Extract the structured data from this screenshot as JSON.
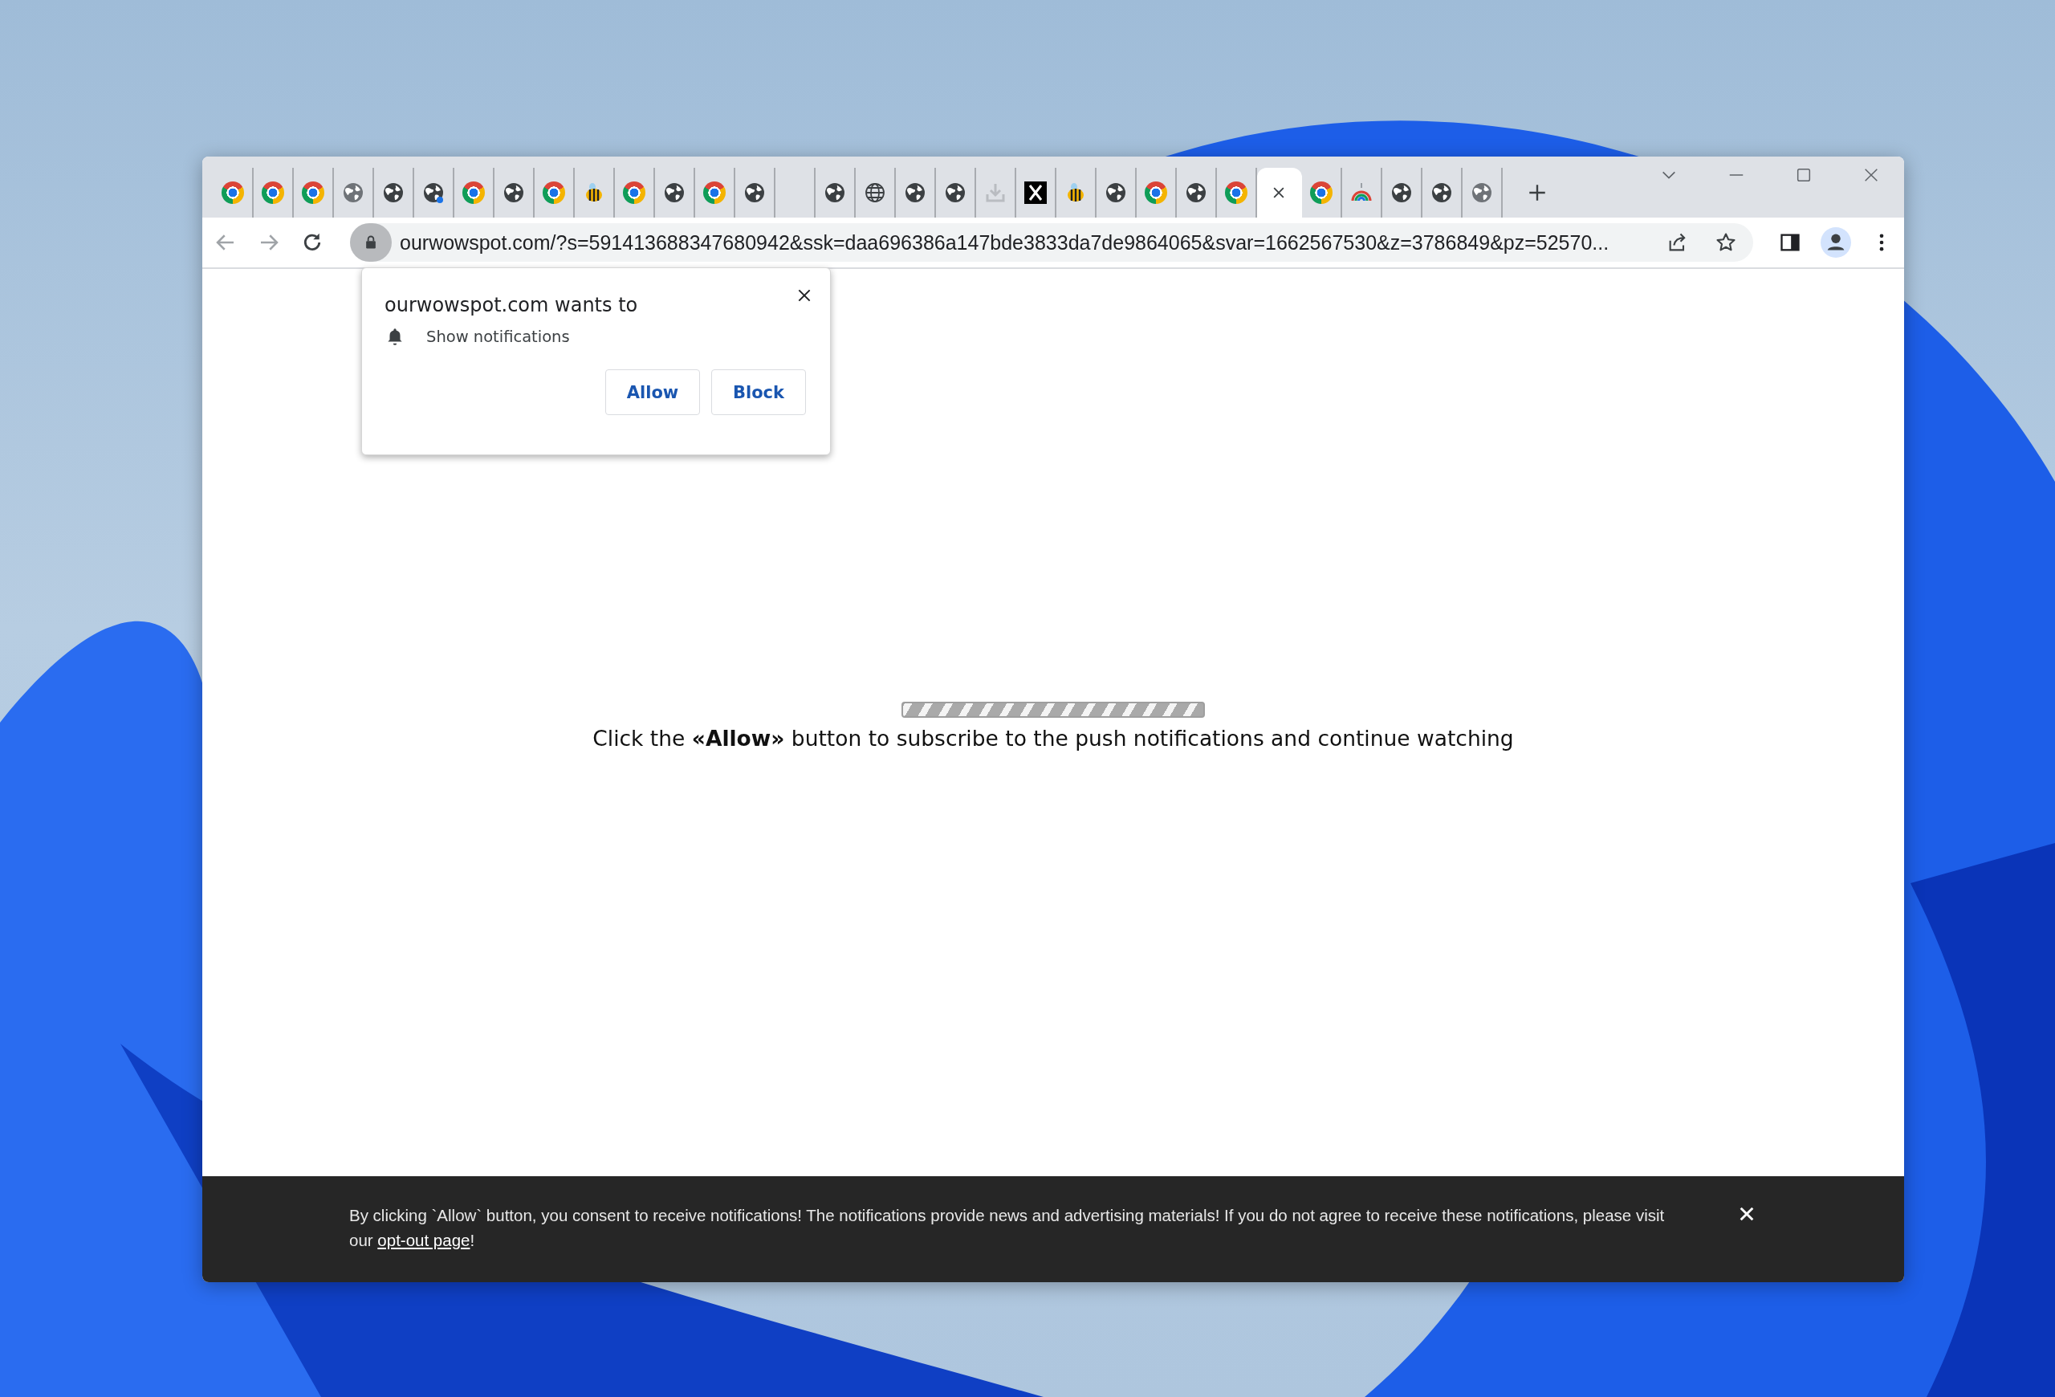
{
  "window": {
    "tabs": [
      {
        "kind": "chrome",
        "selected": false
      },
      {
        "kind": "chrome",
        "selected": false
      },
      {
        "kind": "chrome",
        "selected": false
      },
      {
        "kind": "globe-grey",
        "selected": false
      },
      {
        "kind": "globe",
        "selected": false
      },
      {
        "kind": "globe-dot",
        "selected": false
      },
      {
        "kind": "chrome",
        "selected": false
      },
      {
        "kind": "globe",
        "selected": false
      },
      {
        "kind": "chrome",
        "selected": false
      },
      {
        "kind": "bee",
        "selected": false
      },
      {
        "kind": "chrome",
        "selected": false
      },
      {
        "kind": "globe",
        "selected": false
      },
      {
        "kind": "chrome",
        "selected": false
      },
      {
        "kind": "globe",
        "selected": false
      },
      {
        "kind": "blank",
        "selected": false
      },
      {
        "kind": "globe",
        "selected": false
      },
      {
        "kind": "web",
        "selected": false
      },
      {
        "kind": "globe",
        "selected": false
      },
      {
        "kind": "globe",
        "selected": false
      },
      {
        "kind": "download",
        "selected": false
      },
      {
        "kind": "x",
        "selected": false
      },
      {
        "kind": "bee",
        "selected": false
      },
      {
        "kind": "globe",
        "selected": false
      },
      {
        "kind": "chrome",
        "selected": false
      },
      {
        "kind": "globe",
        "selected": false
      },
      {
        "kind": "chrome",
        "selected": false
      },
      {
        "kind": "blank",
        "selected": true
      },
      {
        "kind": "chrome",
        "selected": false
      },
      {
        "kind": "rainbow",
        "selected": false
      },
      {
        "kind": "globe",
        "selected": false
      },
      {
        "kind": "globe",
        "selected": false
      },
      {
        "kind": "globe-grey",
        "selected": false
      }
    ]
  },
  "address_bar": {
    "url": "ourwowspot.com/?s=591413688347680942&ssk=daa696386a147bde3833da7de9864065&svar=1662567530&z=3786849&pz=52570..."
  },
  "permission_popup": {
    "title": "ourwowspot.com wants to",
    "permission": "Show notifications",
    "buttons": [
      "Allow",
      "Block"
    ]
  },
  "page": {
    "message": "Click the **«Allow»** button to subscribe to the push notifications and continue watching"
  },
  "consent_bar": {
    "text": "By clicking `Allow` button, you consent to receive notifications! The notifications provide news and advertising materials! If you do not agree to receive these notifications, please visit our ",
    "link": "opt-out page",
    "text_end": "!"
  }
}
